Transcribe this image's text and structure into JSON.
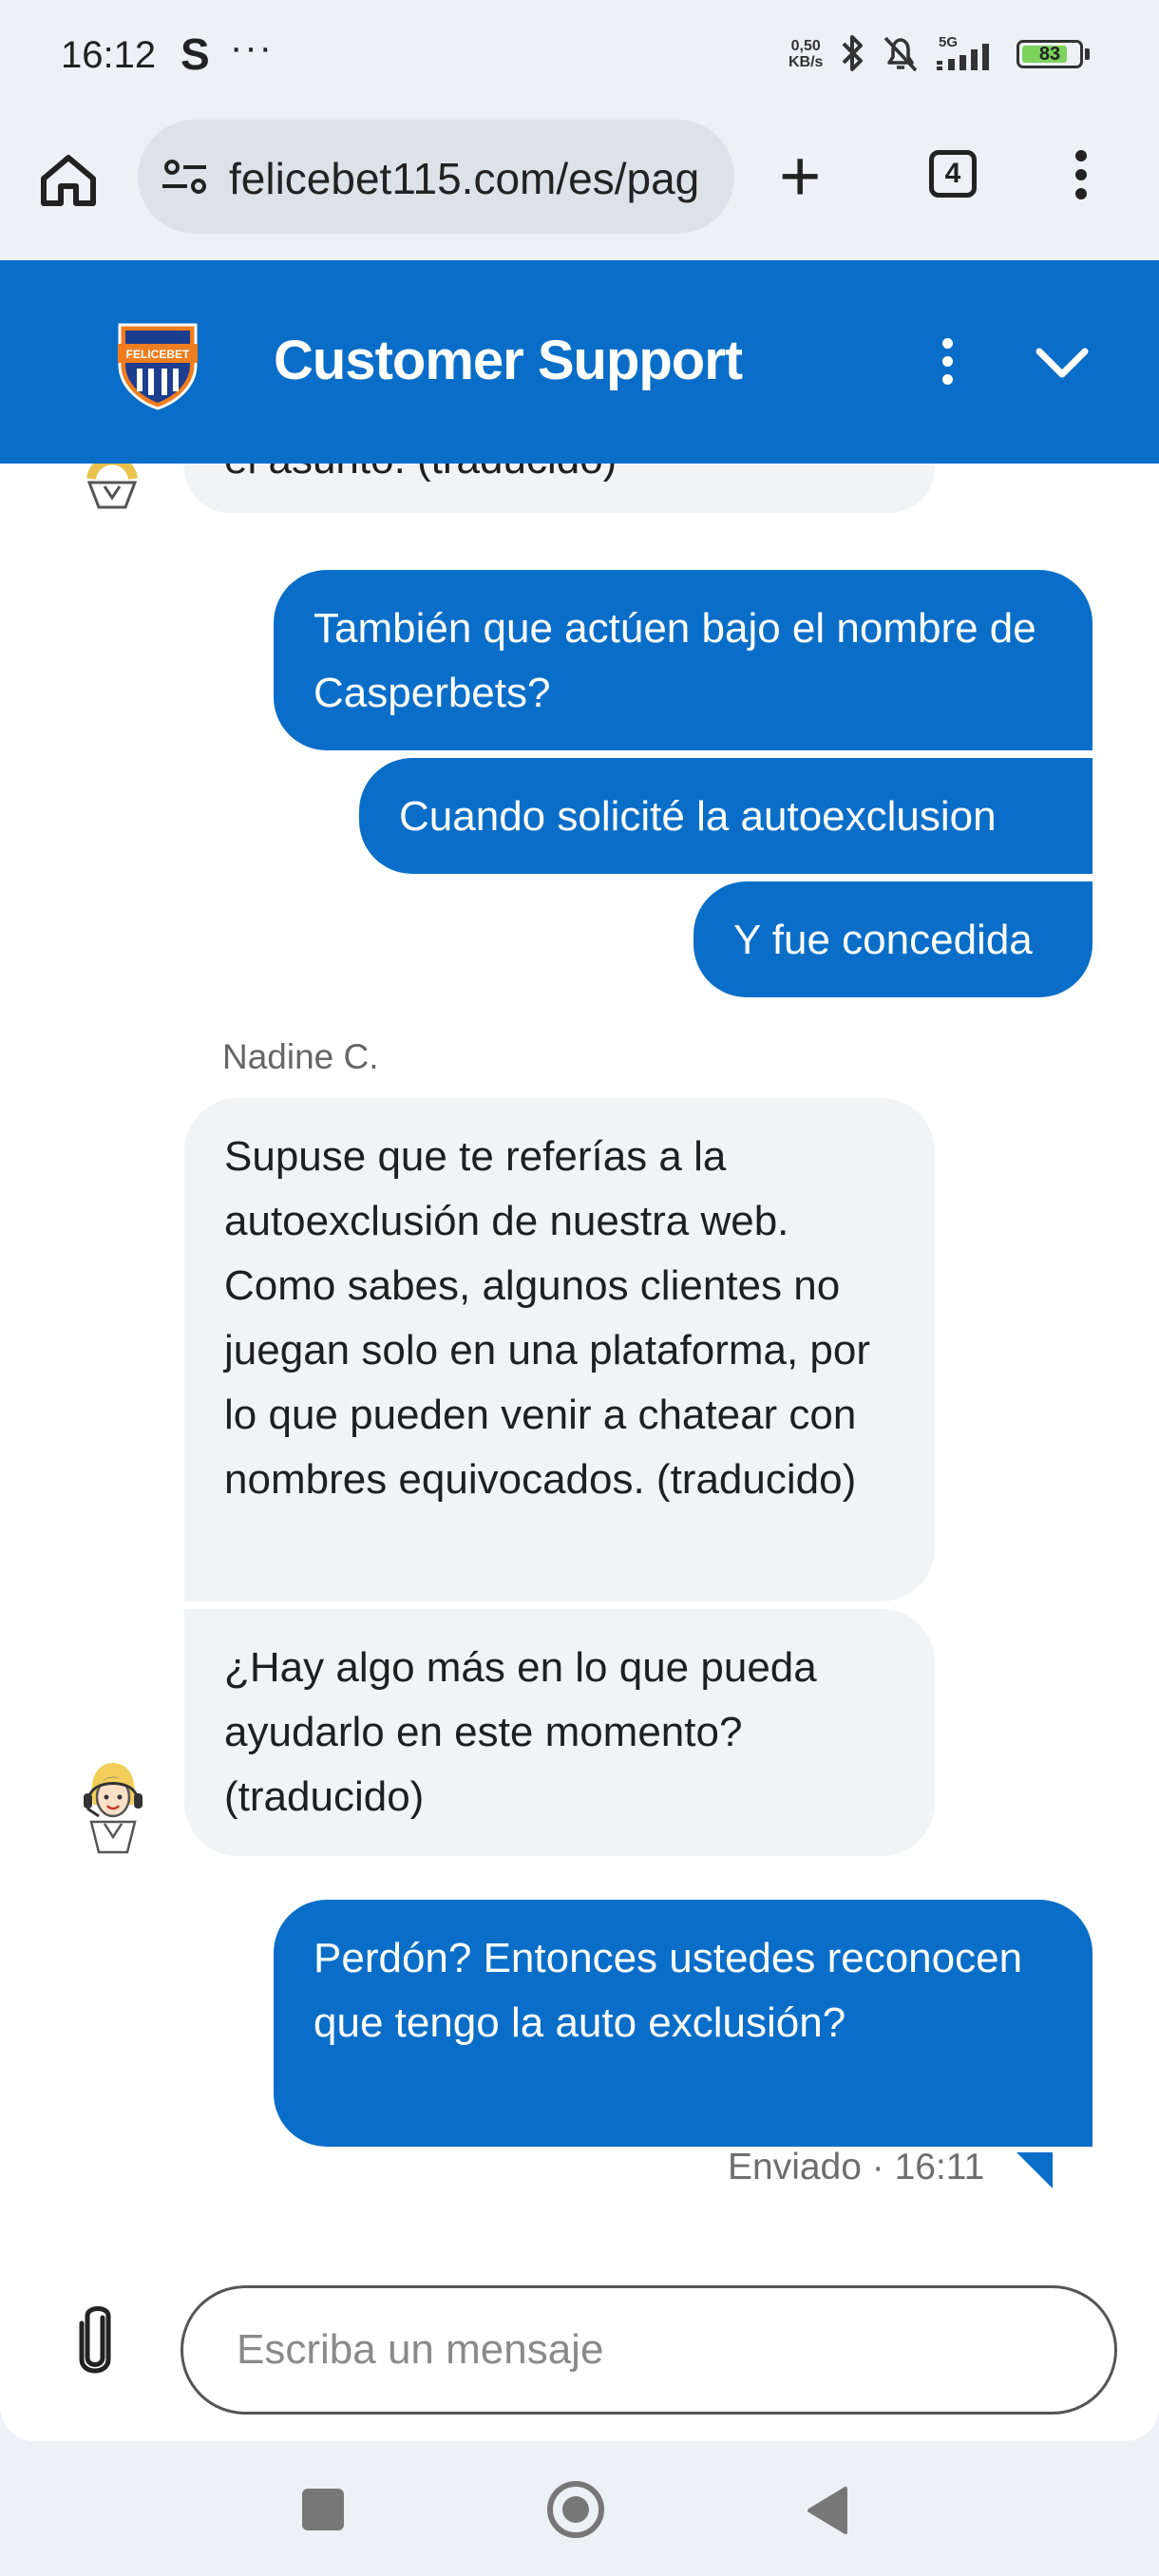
{
  "status_bar": {
    "time": "16:12",
    "s_icon": "S",
    "dots": "···",
    "net_speed_value": "0,50",
    "net_speed_unit": "KB/s",
    "network": "5G",
    "battery": "83",
    "battery_level": 0.83,
    "icons": [
      "bluetooth-icon",
      "bell-off-icon",
      "signal-icon",
      "battery-icon"
    ]
  },
  "browser": {
    "url": "felicebet115.com/es/pag",
    "tab_count": "4",
    "icons": [
      "home-icon",
      "tune-icon",
      "plus-icon",
      "tabs-icon",
      "more-vertical-icon"
    ]
  },
  "chat": {
    "logo_text": "FELICEBET",
    "title": "Customer Support",
    "header_icons": [
      "more-vertical-icon",
      "chevron-down-icon"
    ],
    "messages": [
      {
        "direction": "in",
        "text": "el asunto.  (traducido)"
      },
      {
        "direction": "out",
        "text": "También que actúen bajo el nombre de Casperbets?"
      },
      {
        "direction": "out",
        "text": "Cuando solicité la autoexclusion"
      },
      {
        "direction": "out",
        "text": "Y fue concedida"
      },
      {
        "direction": "in",
        "sender": "Nadine C.",
        "text": "Supuse que te referías a la autoexclusión de nuestra web. Como sabes, algunos clientes no juegan solo en una plataforma, por lo que pueden venir a chatear con nombres equivocados. (traducido)"
      },
      {
        "direction": "in",
        "text": "¿Hay algo más en lo que pueda ayudarlo en este momento? (traducido)"
      },
      {
        "direction": "out",
        "text": "Perdón? Entonces ustedes reconocen que tengo la auto exclusión?"
      }
    ],
    "sent_status": "Enviado · 16:11",
    "composer": {
      "placeholder": "Escriba un mensaje",
      "value": ""
    }
  },
  "nav_bar": {
    "icons": [
      "recents-icon",
      "home-icon",
      "back-icon"
    ]
  },
  "colors": {
    "brand_blue": "#0a6ec8",
    "incoming_bubble": "#f2f3f5",
    "page_background": "#edf0f4"
  }
}
